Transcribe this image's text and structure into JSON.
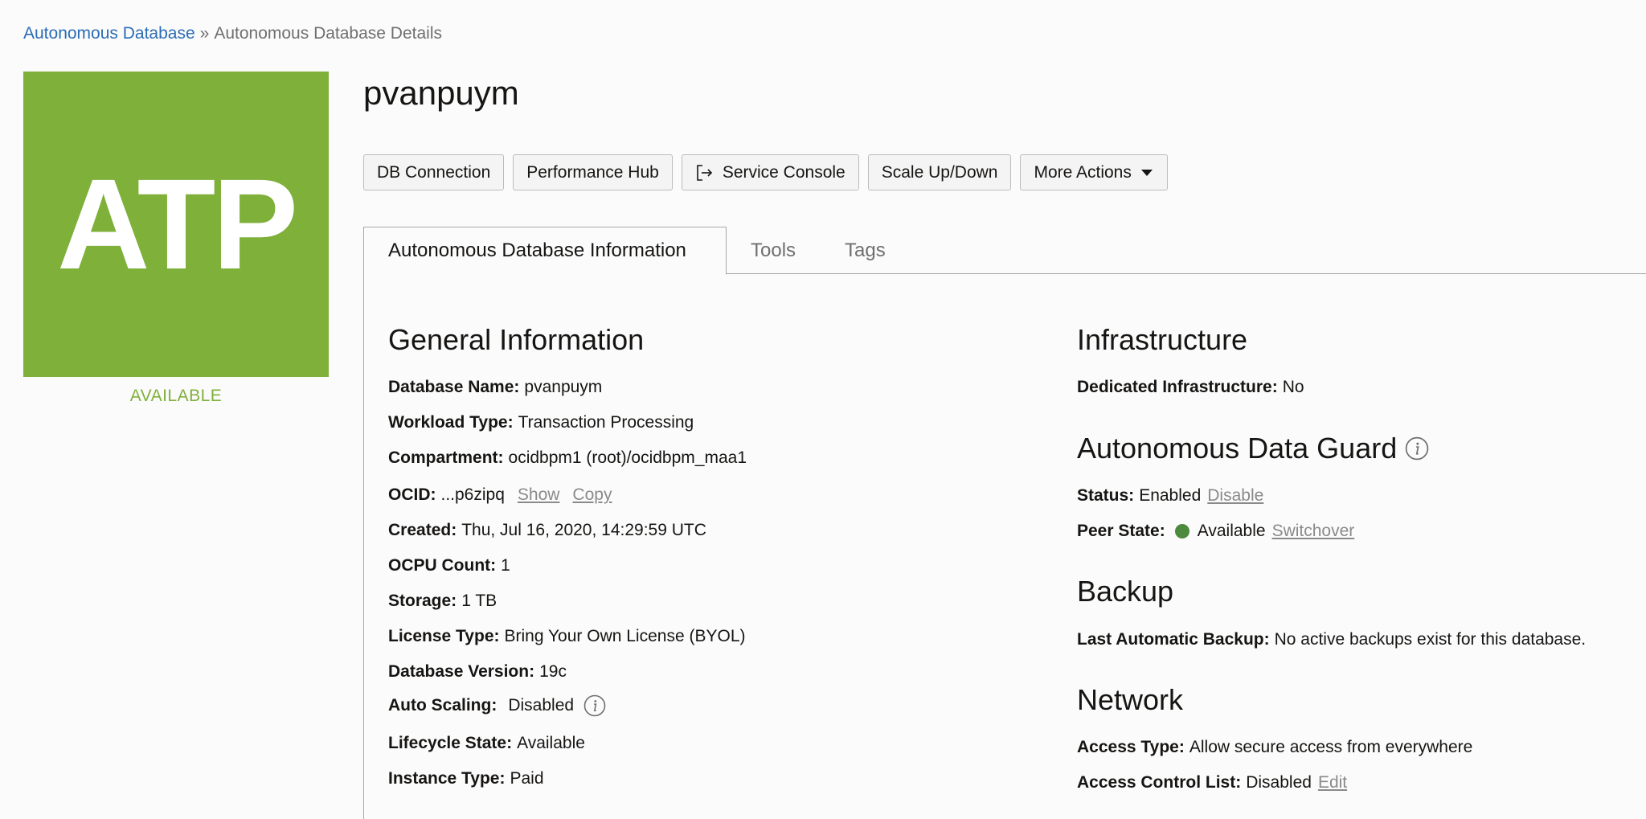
{
  "breadcrumb": {
    "parent": "Autonomous Database",
    "separator": "»",
    "current": "Autonomous Database Details"
  },
  "logo": {
    "text": "ATP",
    "color": "#7fb03a"
  },
  "lifecycle_label": "AVAILABLE",
  "title": "pvanpuym",
  "actions": {
    "db_connection": "DB Connection",
    "performance_hub": "Performance Hub",
    "service_console": "Service Console",
    "scale": "Scale Up/Down",
    "more_actions": "More Actions"
  },
  "tabs": {
    "info": "Autonomous Database Information",
    "tools": "Tools",
    "tags": "Tags"
  },
  "general": {
    "heading": "General Information",
    "database_name": {
      "label": "Database Name:",
      "value": "pvanpuym"
    },
    "workload_type": {
      "label": "Workload Type:",
      "value": "Transaction Processing"
    },
    "compartment": {
      "label": "Compartment:",
      "value": "ocidbpm1 (root)/ocidbpm_maa1"
    },
    "ocid": {
      "label": "OCID:",
      "value": "...p6zipq",
      "show": "Show",
      "copy": "Copy"
    },
    "created": {
      "label": "Created:",
      "value": "Thu, Jul 16, 2020, 14:29:59 UTC"
    },
    "ocpu_count": {
      "label": "OCPU Count:",
      "value": "1"
    },
    "storage": {
      "label": "Storage:",
      "value": "1 TB"
    },
    "license_type": {
      "label": "License Type:",
      "value": "Bring Your Own License (BYOL)"
    },
    "database_version": {
      "label": "Database Version:",
      "value": "19c"
    },
    "auto_scaling": {
      "label": "Auto Scaling:",
      "value": "Disabled"
    },
    "lifecycle_state": {
      "label": "Lifecycle State:",
      "value": "Available"
    },
    "instance_type": {
      "label": "Instance Type:",
      "value": "Paid"
    }
  },
  "infrastructure": {
    "heading": "Infrastructure",
    "dedicated": {
      "label": "Dedicated Infrastructure:",
      "value": "No"
    }
  },
  "data_guard": {
    "heading": "Autonomous Data Guard",
    "status": {
      "label": "Status:",
      "value": "Enabled",
      "action": "Disable"
    },
    "peer_state": {
      "label": "Peer State:",
      "value": "Available",
      "action": "Switchover",
      "dot_color": "#4c8a3e"
    }
  },
  "backup": {
    "heading": "Backup",
    "last_automatic": {
      "label": "Last Automatic Backup:",
      "value": "No active backups exist for this database."
    }
  },
  "network": {
    "heading": "Network",
    "access_type": {
      "label": "Access Type:",
      "value": "Allow secure access from everywhere"
    },
    "acl": {
      "label": "Access Control List:",
      "value": "Disabled",
      "action": "Edit"
    }
  }
}
